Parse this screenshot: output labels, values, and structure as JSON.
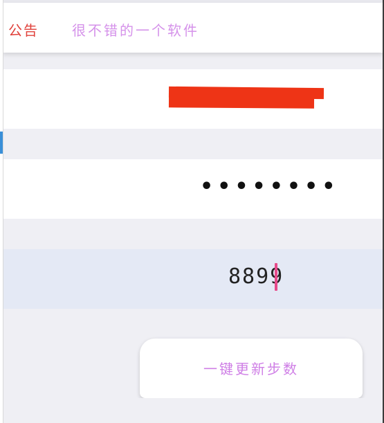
{
  "notice": {
    "label": "公告",
    "text": "很不错的一个软件"
  },
  "account": {
    "value": "redacted"
  },
  "password": {
    "masked_value": "••••••••"
  },
  "steps": {
    "value": "8899"
  },
  "update_button": {
    "label": "一键更新步数"
  },
  "colors": {
    "notice_label": "#e0403a",
    "notice_text": "#d592ea",
    "redaction": "#ee3416",
    "cursor": "#e64a8a",
    "button_text": "#cf7fe6",
    "steps_row_bg": "#e4e9f5",
    "page_bg": "#efeff4"
  }
}
